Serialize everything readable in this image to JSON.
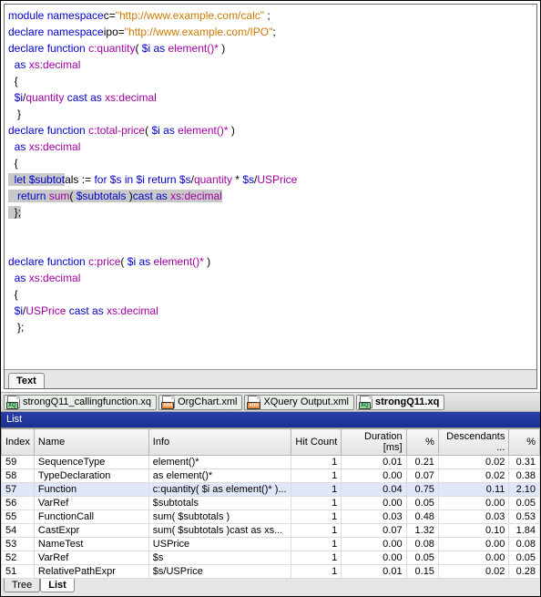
{
  "editor": {
    "tabs": [
      {
        "label": "Text"
      }
    ],
    "activeTab": 0,
    "code_tokens": [
      [
        [
          "kw",
          "module namespace"
        ],
        [
          "",
          ""
        ],
        [
          "",
          "c="
        ],
        [
          "str",
          "\"http://www.example.com/calc\""
        ],
        [
          "",
          " ;"
        ]
      ],
      [
        [
          "kw",
          "declare namespace"
        ],
        [
          "",
          ""
        ],
        [
          "",
          "ipo="
        ],
        [
          "str",
          "\"http://www.example.com/IPO\""
        ],
        [
          "",
          ";"
        ]
      ],
      [
        [
          "kw",
          "declare"
        ],
        [
          "",
          " "
        ],
        [
          "kw",
          "function"
        ],
        [
          "",
          " "
        ],
        [
          "ns",
          "c:quantity"
        ],
        [
          "",
          "( "
        ],
        [
          "var",
          "$i"
        ],
        [
          "",
          " "
        ],
        [
          "kw",
          "as"
        ],
        [
          "",
          " "
        ],
        [
          "typ",
          "element()*"
        ],
        [
          "",
          " )"
        ]
      ],
      [
        [
          "",
          "  "
        ],
        [
          "kw",
          "as"
        ],
        [
          "",
          " "
        ],
        [
          "typ",
          "xs:decimal"
        ]
      ],
      [
        [
          "",
          "  {"
        ]
      ],
      [
        [
          "",
          "  "
        ],
        [
          "var",
          "$i"
        ],
        [
          "",
          "/"
        ],
        [
          "path",
          "quantity"
        ],
        [
          "",
          " "
        ],
        [
          "kw",
          "cast as"
        ],
        [
          "",
          " "
        ],
        [
          "typ",
          "xs:decimal"
        ]
      ],
      [
        [
          "",
          "   }"
        ]
      ],
      [
        [
          "kw",
          "declare"
        ],
        [
          "",
          " "
        ],
        [
          "kw",
          "function"
        ],
        [
          "",
          " "
        ],
        [
          "ns",
          "c:total-price"
        ],
        [
          "",
          "( "
        ],
        [
          "var",
          "$i"
        ],
        [
          "",
          " "
        ],
        [
          "kw",
          "as"
        ],
        [
          "",
          " "
        ],
        [
          "typ",
          "element()*"
        ],
        [
          "",
          " )"
        ]
      ],
      [
        [
          "",
          "  "
        ],
        [
          "kw",
          "as"
        ],
        [
          "",
          " "
        ],
        [
          "typ",
          "xs:decimal"
        ]
      ],
      [
        [
          "",
          "  {"
        ]
      ],
      [
        [
          "hl",
          "  "
        ],
        [
          "kw hl",
          "let"
        ],
        [
          "hl",
          " "
        ],
        [
          "var hl",
          "$subtot"
        ],
        [
          "",
          "als := "
        ],
        [
          "kw",
          "for"
        ],
        [
          "",
          " "
        ],
        [
          "var",
          "$s"
        ],
        [
          "",
          " "
        ],
        [
          "kw",
          "in"
        ],
        [
          "",
          " "
        ],
        [
          "var",
          "$i"
        ],
        [
          "",
          " "
        ],
        [
          "kw",
          "return"
        ],
        [
          "",
          " "
        ],
        [
          "var",
          "$s"
        ],
        [
          "",
          "/"
        ],
        [
          "path",
          "quantity"
        ],
        [
          "",
          " * "
        ],
        [
          "var",
          "$s"
        ],
        [
          "",
          "/"
        ],
        [
          "path",
          "USPrice"
        ]
      ],
      [
        [
          "hl",
          "   "
        ],
        [
          "kw hl",
          "return"
        ],
        [
          "hl",
          " "
        ],
        [
          "ns hl",
          "sum"
        ],
        [
          "hl",
          "( "
        ],
        [
          "var hl",
          "$subtotals"
        ],
        [
          "hl",
          " )"
        ],
        [
          "kw hl",
          "cast as"
        ],
        [
          "hl",
          " "
        ],
        [
          "typ hl",
          "xs:decimal"
        ]
      ],
      [
        [
          "hl",
          "  };"
        ]
      ],
      [
        [
          "",
          ""
        ]
      ],
      [
        [
          "",
          ""
        ]
      ],
      [
        [
          "kw",
          "declare"
        ],
        [
          "",
          " "
        ],
        [
          "kw",
          "function"
        ],
        [
          "",
          " "
        ],
        [
          "ns",
          "c:price"
        ],
        [
          "",
          "( "
        ],
        [
          "var",
          "$i"
        ],
        [
          "",
          " "
        ],
        [
          "kw",
          "as"
        ],
        [
          "",
          " "
        ],
        [
          "typ",
          "element()*"
        ],
        [
          "",
          " )"
        ]
      ],
      [
        [
          "",
          "  "
        ],
        [
          "kw",
          "as"
        ],
        [
          "",
          " "
        ],
        [
          "typ",
          "xs:decimal"
        ]
      ],
      [
        [
          "",
          "  {"
        ]
      ],
      [
        [
          "",
          "  "
        ],
        [
          "var",
          "$i"
        ],
        [
          "",
          "/"
        ],
        [
          "path",
          "USPrice"
        ],
        [
          "",
          " "
        ],
        [
          "kw",
          "cast as"
        ],
        [
          "",
          " "
        ],
        [
          "typ",
          "xs:decimal"
        ]
      ],
      [
        [
          "",
          "   };"
        ]
      ]
    ]
  },
  "fileTabs": [
    {
      "label": "strongQ11_callingfunction.xq",
      "badge": "XQ",
      "badgeClass": ""
    },
    {
      "label": "OrgChart.xml",
      "badge": "xml",
      "badgeClass": "xml"
    },
    {
      "label": "XQuery Output.xml",
      "badge": "xml",
      "badgeClass": "xml"
    },
    {
      "label": "strongQ11.xq",
      "badge": "XQ",
      "badgeClass": ""
    }
  ],
  "fileTabActive": 3,
  "listTitle": "List",
  "grid": {
    "headers": [
      "Index",
      "Name",
      "Info",
      "Hit Count",
      "Duration [ms]",
      "%",
      "Descendants ...",
      "%"
    ],
    "rows": [
      {
        "index": "59",
        "name": "SequenceType",
        "info": "element()*",
        "hit": "1",
        "dur": "0.01",
        "pct": "0.21",
        "desc": "0.02",
        "pct2": "0.31",
        "selected": false
      },
      {
        "index": "58",
        "name": "TypeDeclaration",
        "info": "as element()*",
        "hit": "1",
        "dur": "0.00",
        "pct": "0.07",
        "desc": "0.02",
        "pct2": "0.38",
        "selected": false
      },
      {
        "index": "57",
        "name": "Function",
        "info": "c:quantity( $i as element()* )...",
        "hit": "1",
        "dur": "0.04",
        "pct": "0.75",
        "desc": "0.11",
        "pct2": "2.10",
        "selected": true
      },
      {
        "index": "56",
        "name": "VarRef",
        "info": "$subtotals",
        "hit": "1",
        "dur": "0.00",
        "pct": "0.05",
        "desc": "0.00",
        "pct2": "0.05",
        "selected": false
      },
      {
        "index": "55",
        "name": "FunctionCall",
        "info": "sum( $subtotals )",
        "hit": "1",
        "dur": "0.03",
        "pct": "0.48",
        "desc": "0.03",
        "pct2": "0.53",
        "selected": false
      },
      {
        "index": "54",
        "name": "CastExpr",
        "info": "sum( $subtotals )cast as xs...",
        "hit": "1",
        "dur": "0.07",
        "pct": "1.32",
        "desc": "0.10",
        "pct2": "1.84",
        "selected": false
      },
      {
        "index": "53",
        "name": "NameTest",
        "info": "USPrice",
        "hit": "1",
        "dur": "0.00",
        "pct": "0.08",
        "desc": "0.00",
        "pct2": "0.08",
        "selected": false
      },
      {
        "index": "52",
        "name": "VarRef",
        "info": "$s",
        "hit": "1",
        "dur": "0.00",
        "pct": "0.05",
        "desc": "0.00",
        "pct2": "0.05",
        "selected": false
      },
      {
        "index": "51",
        "name": "RelativePathExpr",
        "info": "$s/USPrice",
        "hit": "1",
        "dur": "0.01",
        "pct": "0.15",
        "desc": "0.02",
        "pct2": "0.28",
        "selected": false
      }
    ]
  },
  "bottomTabs": [
    {
      "label": "Tree"
    },
    {
      "label": "List"
    }
  ],
  "bottomTabActive": 1
}
